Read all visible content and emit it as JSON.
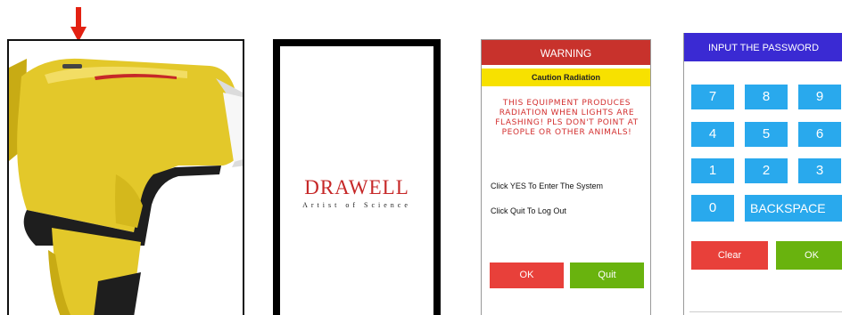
{
  "splash": {
    "brand": "DRAWELL",
    "tagline": "Artist of Science"
  },
  "warning": {
    "title": "WARNING",
    "subtitle": "Caution Radiation",
    "message_lines": [
      "THIS EQUIPMENT PRODUCES",
      "RADIATION WHEN LIGHTS ARE",
      "FLASHING! PLS DON'T POINT AT",
      "PEOPLE OR OTHER ANIMALS!"
    ],
    "instruction_yes": "Click YES To Enter The System",
    "instruction_quit": "Click Quit To Log Out",
    "ok_label": "OK",
    "quit_label": "Quit"
  },
  "password": {
    "title": "INPUT THE PASSWORD",
    "keys": [
      "7",
      "8",
      "9",
      "4",
      "5",
      "6",
      "1",
      "2",
      "3"
    ],
    "zero": "0",
    "backspace": "BACKSPACE",
    "clear_label": "Clear",
    "ok_label": "OK"
  },
  "colors": {
    "warning_red": "#c8322c",
    "caution_yellow": "#f7e100",
    "ok_red": "#e8403a",
    "quit_green": "#69b30e",
    "password_header": "#3a2ad3",
    "key_blue": "#29a9ed",
    "device_yellow": "#e3c82a",
    "arrow_red": "#e32112"
  }
}
